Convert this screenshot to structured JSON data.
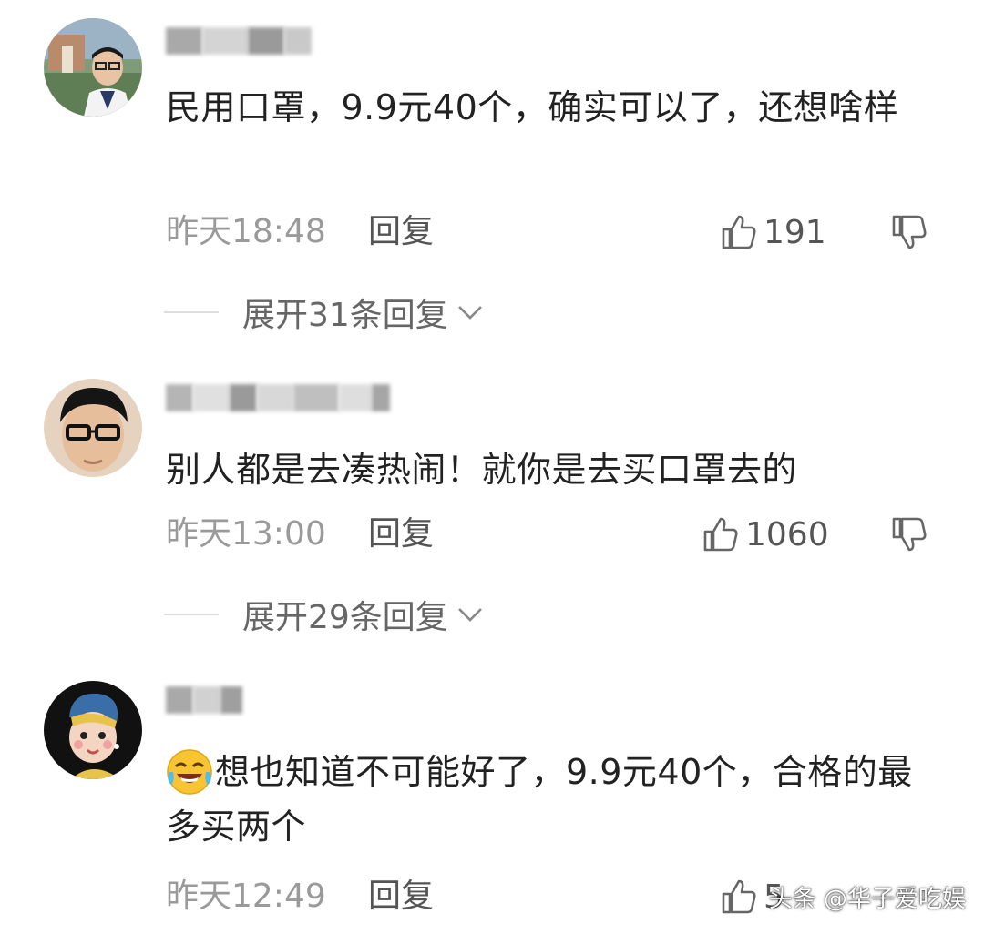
{
  "comments": [
    {
      "text": "民用口罩，9.9元40个，确实可以了，还想啥样",
      "time": "昨天18:48",
      "reply_label": "回复",
      "likes": "191",
      "expand_label": "展开31条回复"
    },
    {
      "text": "别人都是去凑热闹！就你是去买口罩去的",
      "time": "昨天13:00",
      "reply_label": "回复",
      "likes": "1060",
      "expand_label": "展开29条回复"
    },
    {
      "text": "想也知道不可能好了，9.9元40个，合格的最多买两个",
      "time": "昨天12:49",
      "reply_label": "回复",
      "likes": "5"
    }
  ],
  "watermark": "头条 @华子爱吃娱",
  "icons": {
    "like": "thumbs-up-icon",
    "dislike": "thumbs-down-icon",
    "expand": "chevron-down-icon",
    "emoji": "laughing-crying-emoji"
  },
  "colors": {
    "text": "#222222",
    "meta": "#9a9a9a",
    "secondary": "#555555"
  }
}
